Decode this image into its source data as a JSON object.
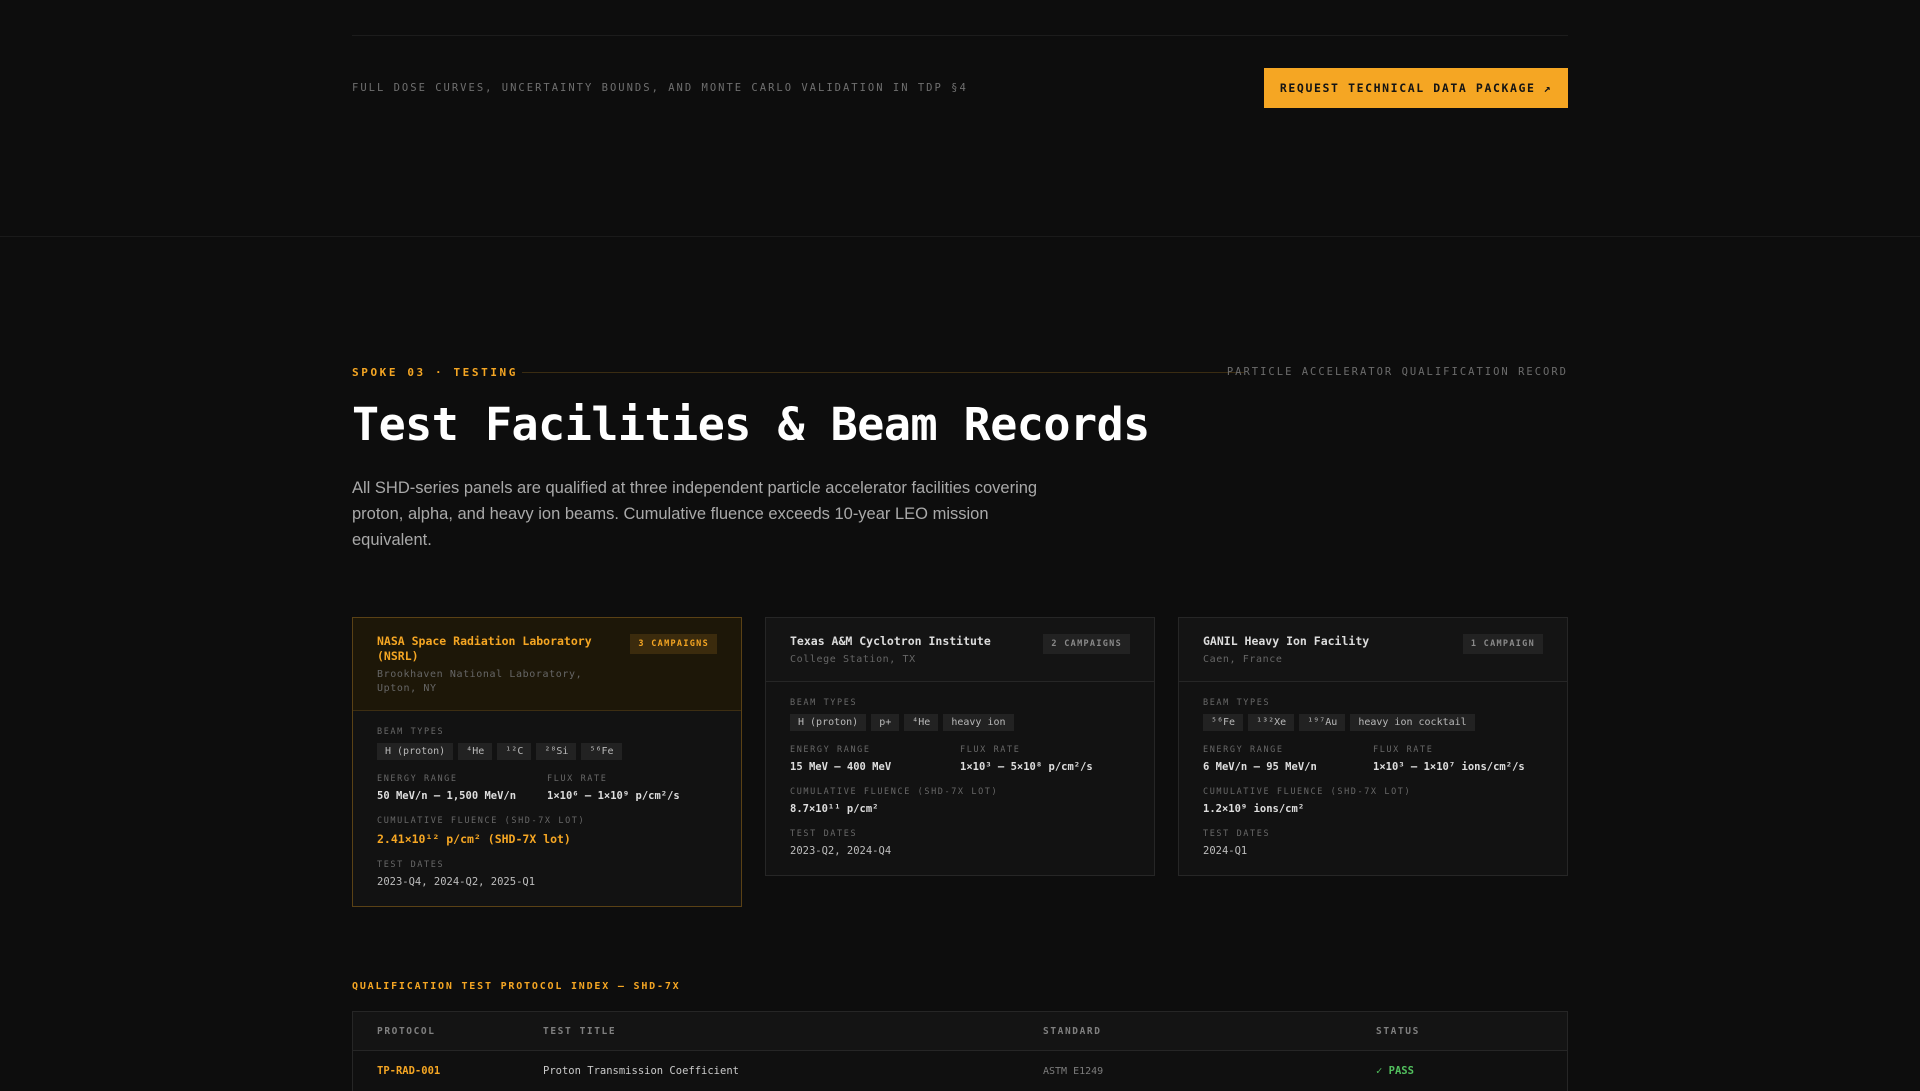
{
  "top": {
    "note": "FULL DOSE CURVES, UNCERTAINTY BOUNDS, AND MONTE CARLO VALIDATION IN TDP §4",
    "cta_label": "REQUEST TECHNICAL DATA PACKAGE",
    "cta_icon": "↗"
  },
  "section": {
    "eyebrow": "SPOKE 03 · TESTING",
    "eyebrow_right": "PARTICLE ACCELERATOR QUALIFICATION RECORD",
    "title": "Test Facilities & Beam Records",
    "intro": "All SHD-series panels are qualified at three independent particle accelerator facilities covering proton, alpha, and heavy ion beams. Cumulative fluence exceeds 10-year LEO mission equivalent."
  },
  "labels": {
    "beam_types": "BEAM TYPES",
    "energy_range": "ENERGY RANGE",
    "flux_rate": "FLUX RATE",
    "cumulative_fluence": "CUMULATIVE FLUENCE (SHD-7X LOT)",
    "test_dates": "TEST DATES"
  },
  "facilities": [
    {
      "name": "NASA Space Radiation Laboratory (NSRL)",
      "location": "Brookhaven National Laboratory, Upton, NY",
      "badge": "3 CAMPAIGNS",
      "beams": [
        "H (proton)",
        "⁴He",
        "¹²C",
        "²⁸Si",
        "⁵⁶Fe"
      ],
      "energy": "50 MeV/n – 1,500 MeV/n",
      "flux": "1×10⁶ – 1×10⁹ p/cm²/s",
      "fluence": "2.41×10¹² p/cm² (SHD-7X lot)",
      "dates": "2023-Q4, 2024-Q2, 2025-Q1"
    },
    {
      "name": "Texas A&M Cyclotron Institute",
      "location": "College Station, TX",
      "badge": "2 CAMPAIGNS",
      "beams": [
        "H (proton)",
        "p+",
        "⁴He",
        "heavy ion"
      ],
      "energy": "15 MeV – 400 MeV",
      "flux": "1×10³ – 5×10⁸ p/cm²/s",
      "fluence": "8.7×10¹¹ p/cm²",
      "dates": "2023-Q2, 2024-Q4"
    },
    {
      "name": "GANIL Heavy Ion Facility",
      "location": "Caen, France",
      "badge": "1 CAMPAIGN",
      "beams": [
        "⁵⁶Fe",
        "¹³²Xe",
        "¹⁹⁷Au",
        "heavy ion cocktail"
      ],
      "energy": "6 MeV/n – 95 MeV/n",
      "flux": "1×10³ – 1×10⁷ ions/cm²/s",
      "fluence": "1.2×10⁹ ions/cm²",
      "dates": "2024-Q1"
    }
  ],
  "protocols": {
    "title": "QUALIFICATION TEST PROTOCOL INDEX — SHD-7X",
    "headers": [
      "PROTOCOL",
      "TEST TITLE",
      "STANDARD",
      "STATUS"
    ],
    "rows": [
      {
        "protocol": "TP-RAD-001",
        "title": "Proton Transmission Coefficient",
        "standard": "ASTM E1249",
        "status": "✓ PASS"
      }
    ]
  }
}
